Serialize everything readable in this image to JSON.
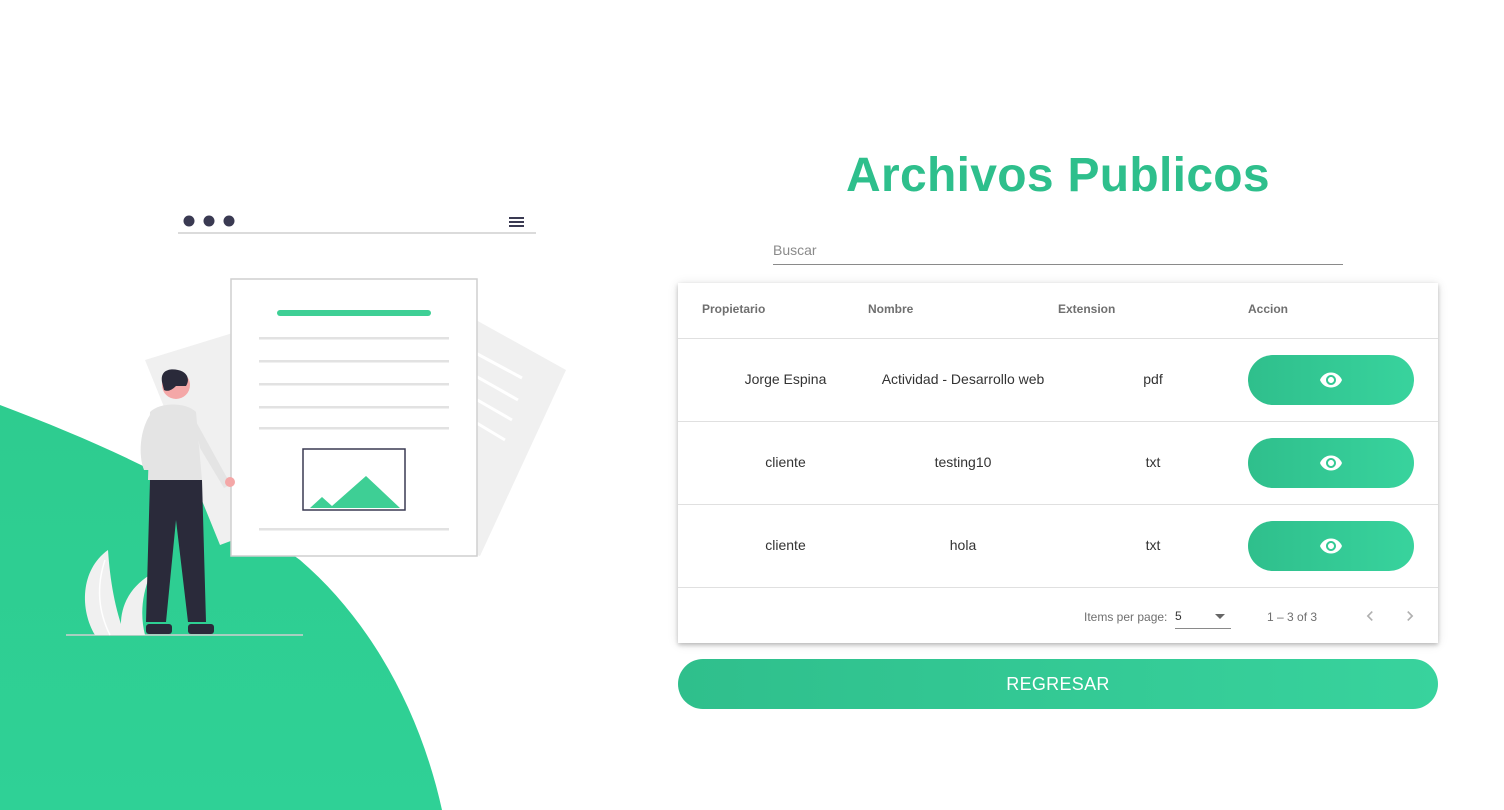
{
  "page": {
    "title": "Archivos Publicos",
    "accent_color": "#2ebf8c"
  },
  "search": {
    "placeholder": "Buscar",
    "value": ""
  },
  "table": {
    "headers": {
      "owner": "Propietario",
      "name": "Nombre",
      "extension": "Extension",
      "action": "Accion"
    },
    "rows": [
      {
        "owner": "Jorge Espina",
        "name": "Actividad - Desarrollo web",
        "extension": "pdf",
        "action_icon": "eye-icon"
      },
      {
        "owner": "cliente",
        "name": "testing10",
        "extension": "txt",
        "action_icon": "eye-icon"
      },
      {
        "owner": "cliente",
        "name": "hola",
        "extension": "txt",
        "action_icon": "eye-icon"
      }
    ]
  },
  "paginator": {
    "items_per_page_label": "Items per page:",
    "items_per_page_value": "5",
    "range_label": "1 – 3 of 3",
    "prev_icon": "chevron-left-icon",
    "next_icon": "chevron-right-icon"
  },
  "actions": {
    "back_label": "REGRESAR"
  }
}
